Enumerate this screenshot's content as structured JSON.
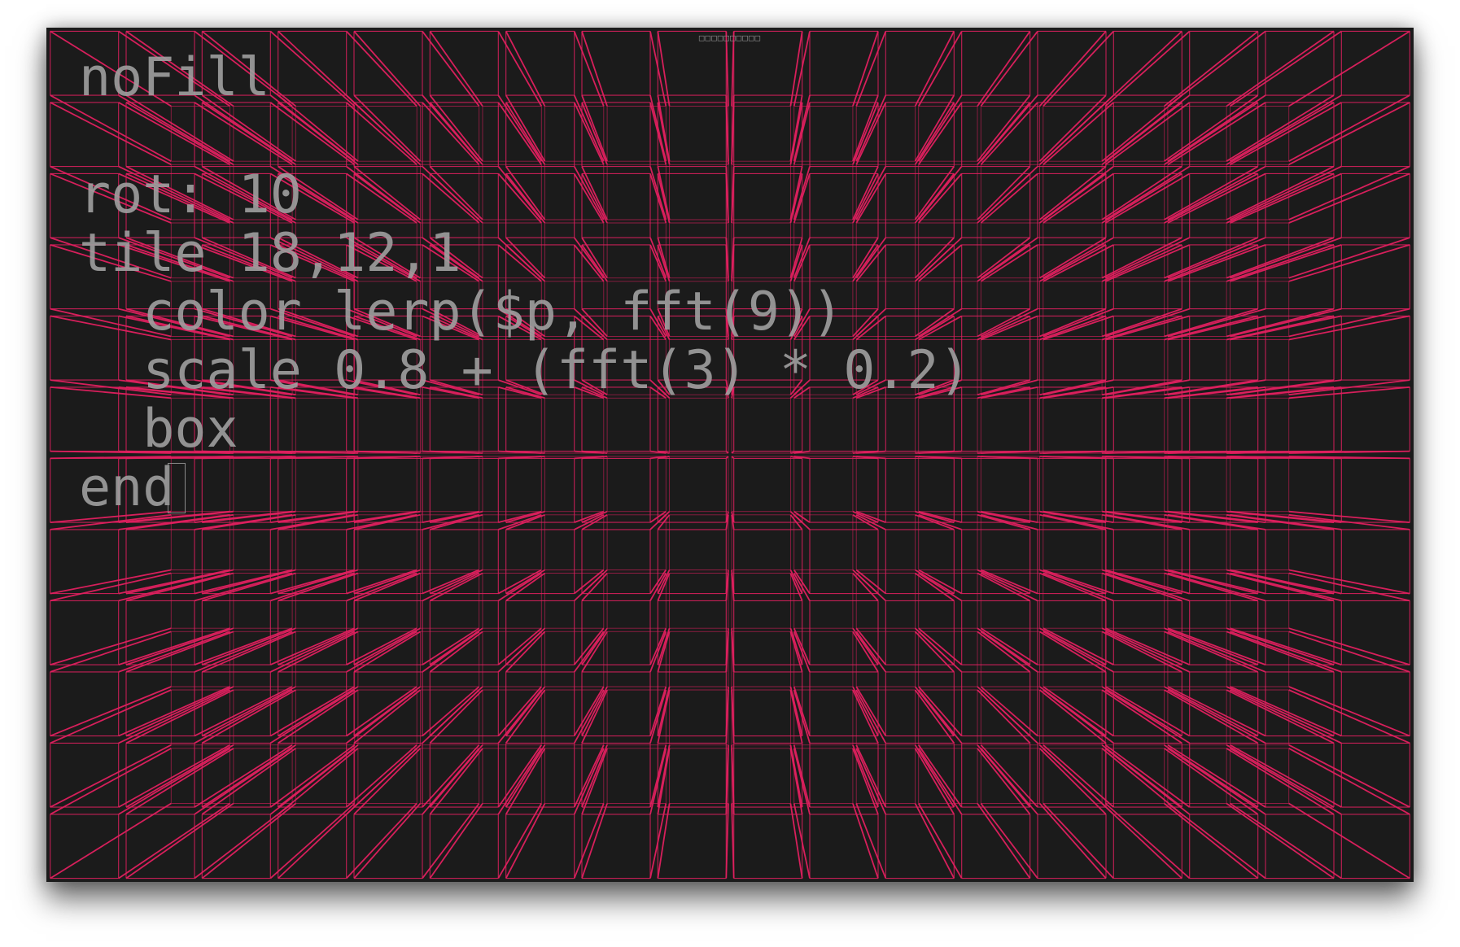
{
  "window": {
    "title": "□□□□□□□□□□"
  },
  "editor": {
    "lines": [
      "noFill",
      "",
      "rot: 10",
      "tile 18,12,1",
      "  color lerp($p, fft(9))",
      "  scale 0.8 + (fft(3) * 0.2)",
      "  box",
      "end"
    ]
  },
  "scene": {
    "grid_columns": 18,
    "grid_rows": 12,
    "line_color": "#e0205f",
    "background_color": "#1b1b1b"
  }
}
